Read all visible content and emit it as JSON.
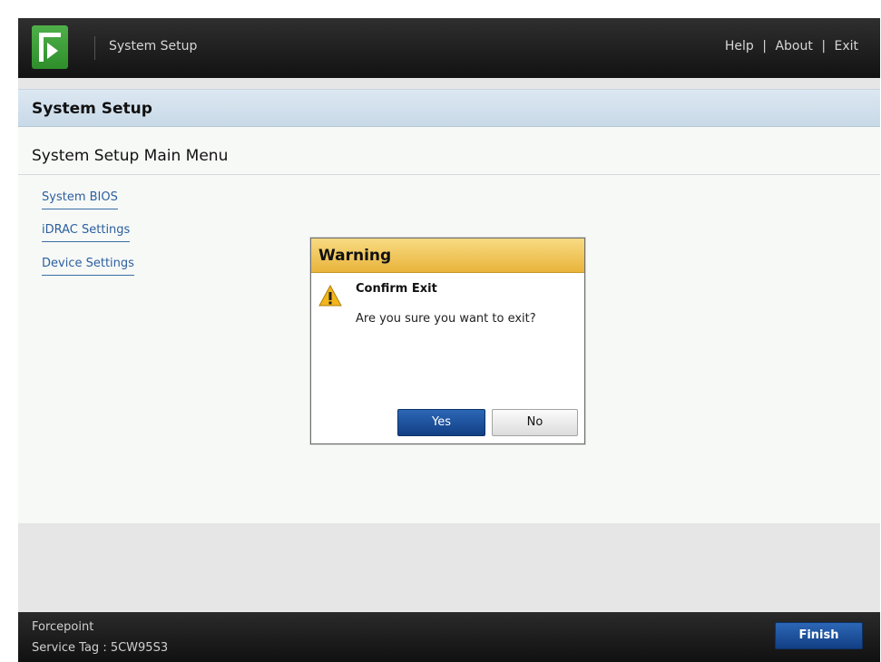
{
  "header": {
    "app_title": "System Setup",
    "links": [
      "Help",
      "About",
      "Exit"
    ],
    "separator": "|"
  },
  "panel": {
    "title": "System Setup",
    "section_title": "System Setup Main Menu",
    "menu_items": [
      "System BIOS",
      "iDRAC Settings",
      "Device Settings"
    ]
  },
  "dialog": {
    "title": "Warning",
    "heading": "Confirm Exit",
    "message": "Are you sure you want to exit?",
    "yes_label": "Yes",
    "no_label": "No",
    "icon": "warning-icon"
  },
  "footer": {
    "vendor": "Forcepoint",
    "service_tag": "Service Tag : 5CW95S3",
    "finish_label": "Finish"
  },
  "colors": {
    "logo_green": "#3a9e36",
    "link_blue": "#2b5f9e",
    "primary_button": "#1b4f99",
    "warning_header": "#f0c45a"
  }
}
